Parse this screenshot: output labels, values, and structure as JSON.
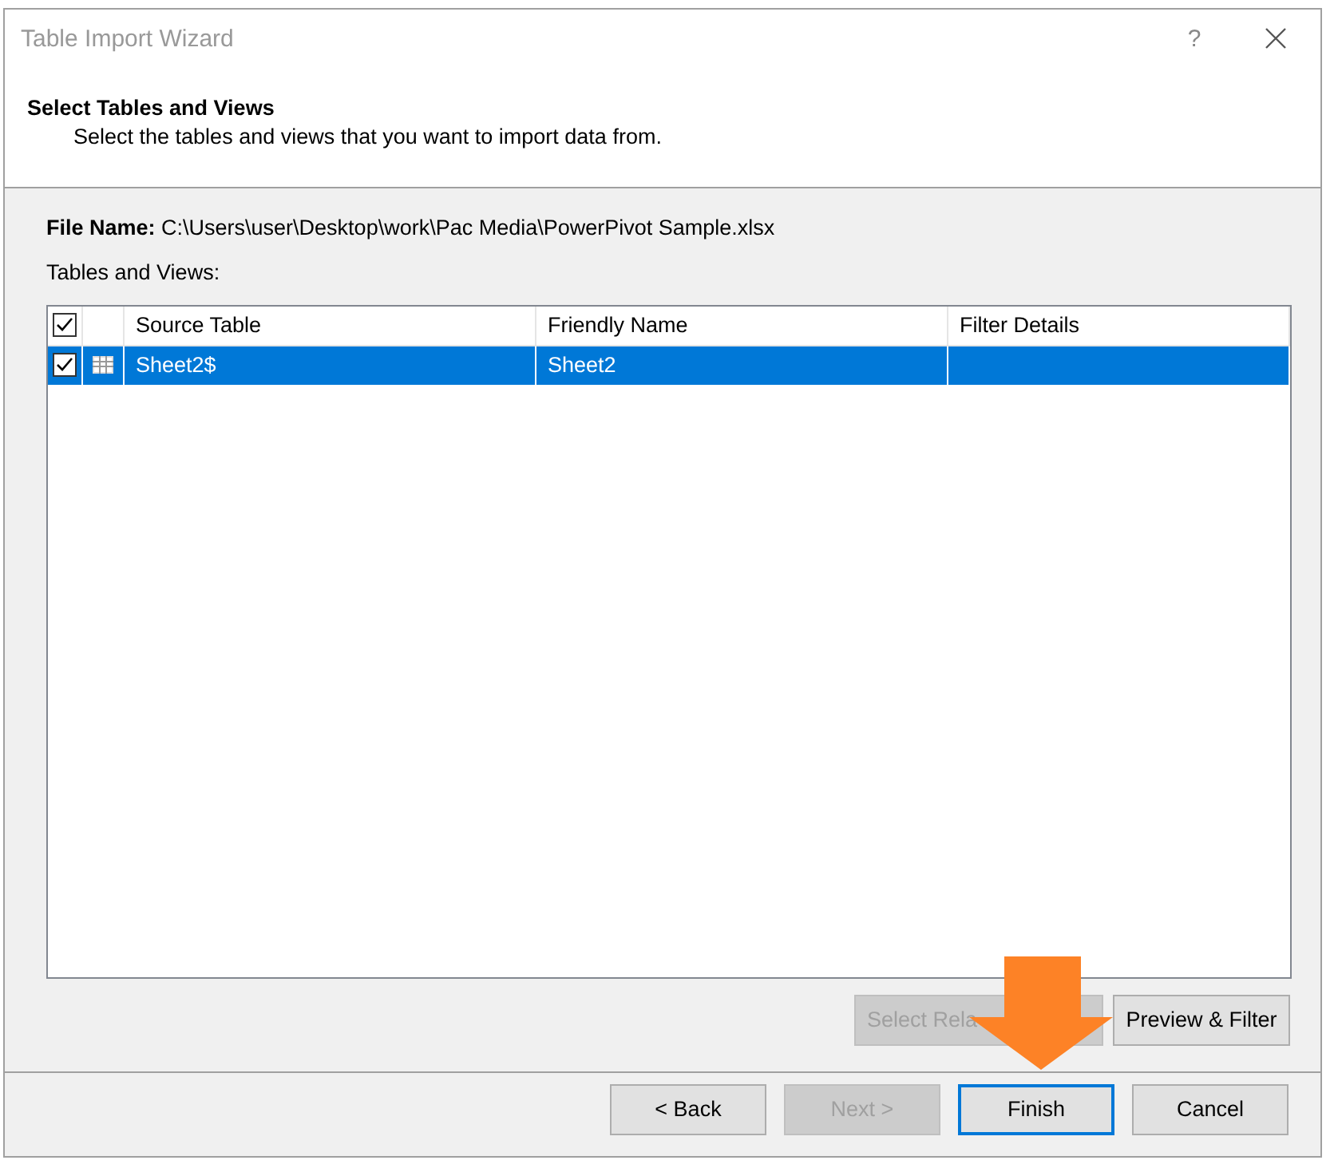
{
  "window": {
    "title": "Table Import Wizard",
    "help": "?"
  },
  "header": {
    "title": "Select Tables and Views",
    "subtitle": "Select the tables and views that you want to import data from."
  },
  "file_name": "**File Name:** C:\\Users\\user\\Desktop\\work\\Pac Media\\PowerPivot Sample.xlsx",
  "list_label": "Tables and Views:",
  "table": {
    "all_checked": true,
    "columns": [
      "Source Table",
      "Friendly Name",
      "Filter Details"
    ],
    "rows": [
      {
        "checked": true,
        "selected": true,
        "source": "Sheet2$",
        "friendly": "Sheet2"
      }
    ]
  },
  "table_buttons": [
    {
      "label": "Select Rela",
      "disabled": true
    },
    {
      "label": "Preview & Filter",
      "disabled": false
    }
  ],
  "buttons": [
    {
      "label": "< Back",
      "disabled": false,
      "default": false
    },
    {
      "label": "Next >",
      "disabled": true,
      "default": false
    },
    {
      "label": "Finish",
      "disabled": false,
      "default": true
    },
    {
      "label": "Cancel",
      "disabled": false,
      "default": false
    }
  ]
}
